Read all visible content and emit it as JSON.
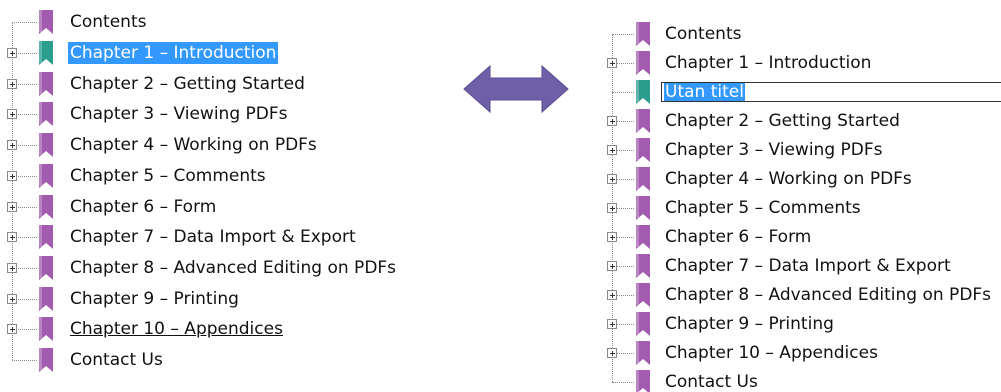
{
  "left_tree": {
    "items": [
      {
        "label": "Contents",
        "color": "#a25bae",
        "expander": false,
        "state": "normal"
      },
      {
        "label": "Chapter 1 – Introduction",
        "color": "#2a9d8f",
        "expander": true,
        "state": "selected"
      },
      {
        "label": "Chapter 2 – Getting Started",
        "color": "#a25bae",
        "expander": true,
        "state": "normal"
      },
      {
        "label": "Chapter 3 – Viewing PDFs",
        "color": "#a25bae",
        "expander": true,
        "state": "normal"
      },
      {
        "label": "Chapter 4 – Working on PDFs",
        "color": "#a25bae",
        "expander": true,
        "state": "normal"
      },
      {
        "label": "Chapter 5 – Comments",
        "color": "#a25bae",
        "expander": true,
        "state": "normal"
      },
      {
        "label": "Chapter 6 – Form",
        "color": "#a25bae",
        "expander": true,
        "state": "normal"
      },
      {
        "label": "Chapter 7 – Data Import & Export",
        "color": "#a25bae",
        "expander": true,
        "state": "normal"
      },
      {
        "label": "Chapter 8 – Advanced Editing on PDFs",
        "color": "#a25bae",
        "expander": true,
        "state": "normal"
      },
      {
        "label": "Chapter 9 – Printing",
        "color": "#a25bae",
        "expander": true,
        "state": "normal"
      },
      {
        "label": "Chapter 10 – Appendices",
        "color": "#a25bae",
        "expander": true,
        "state": "underlined"
      },
      {
        "label": "Contact Us",
        "color": "#a25bae",
        "expander": false,
        "state": "normal"
      }
    ]
  },
  "right_tree": {
    "items": [
      {
        "label": "Contents",
        "color": "#a25bae",
        "expander": false,
        "state": "normal"
      },
      {
        "label": "Chapter 1 – Introduction",
        "color": "#a25bae",
        "expander": true,
        "state": "normal"
      },
      {
        "label": "Utan titel",
        "color": "#2a9d8f",
        "expander": false,
        "state": "editing"
      },
      {
        "label": "Chapter 2 – Getting Started",
        "color": "#a25bae",
        "expander": true,
        "state": "normal"
      },
      {
        "label": "Chapter 3 – Viewing PDFs",
        "color": "#a25bae",
        "expander": true,
        "state": "normal"
      },
      {
        "label": "Chapter 4 – Working on PDFs",
        "color": "#a25bae",
        "expander": true,
        "state": "normal"
      },
      {
        "label": "Chapter 5 – Comments",
        "color": "#a25bae",
        "expander": true,
        "state": "normal"
      },
      {
        "label": "Chapter 6 – Form",
        "color": "#a25bae",
        "expander": true,
        "state": "normal"
      },
      {
        "label": "Chapter 7 – Data Import & Export",
        "color": "#a25bae",
        "expander": true,
        "state": "normal"
      },
      {
        "label": "Chapter 8 – Advanced Editing on PDFs",
        "color": "#a25bae",
        "expander": true,
        "state": "normal"
      },
      {
        "label": "Chapter 9 – Printing",
        "color": "#a25bae",
        "expander": true,
        "state": "normal"
      },
      {
        "label": "Chapter 10 – Appendices",
        "color": "#a25bae",
        "expander": true,
        "state": "normal"
      },
      {
        "label": "Contact Us",
        "color": "#a25bae",
        "expander": false,
        "state": "normal"
      }
    ]
  },
  "colors": {
    "selection": "#3399ff",
    "arrow": "#6f5fa8"
  }
}
